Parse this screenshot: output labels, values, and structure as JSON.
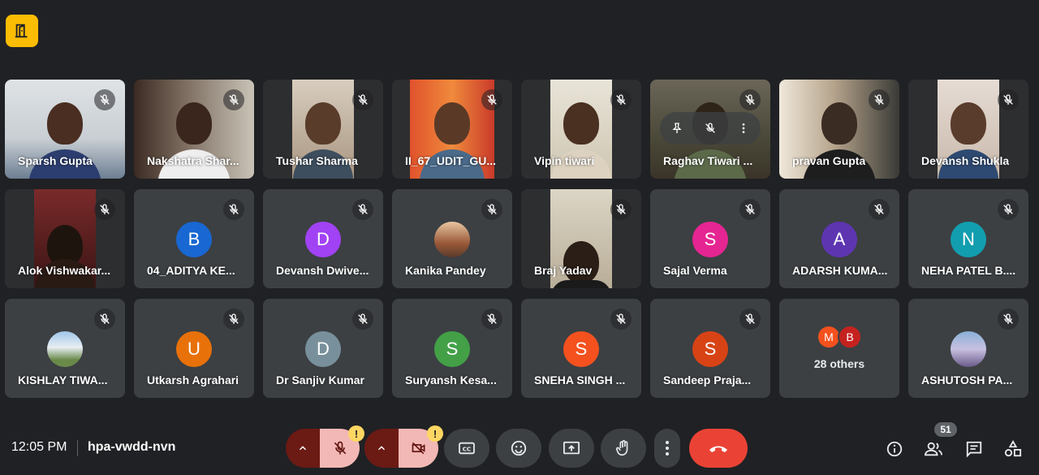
{
  "meeting": {
    "time": "12:05 PM",
    "code": "hpa-vwdd-nvn",
    "participant_count": "51"
  },
  "top_badge_icon": "door-exit-icon",
  "tiles": [
    {
      "name": "Sparsh Gupta"
    },
    {
      "name": "Nakshatra Shar..."
    },
    {
      "name": "Tushar Sharma"
    },
    {
      "name": "II_67_UDIT_GU..."
    },
    {
      "name": "Vipin tiwari"
    },
    {
      "name": "Raghav Tiwari ..."
    },
    {
      "name": "pravan Gupta"
    },
    {
      "name": "Devansh Shukla"
    },
    {
      "name": "Alok Vishwakar..."
    },
    {
      "name": "04_ADITYA KE...",
      "initial": "B",
      "color": "#1967d2"
    },
    {
      "name": "Devansh Dwive...",
      "initial": "D",
      "color": "#a142f4"
    },
    {
      "name": "Kanika Pandey"
    },
    {
      "name": "Braj Yadav"
    },
    {
      "name": "Sajal Verma",
      "initial": "S",
      "color": "#e52592"
    },
    {
      "name": "ADARSH KUMA...",
      "initial": "A",
      "color": "#5e35b1"
    },
    {
      "name": "NEHA PATEL B....",
      "initial": "N",
      "color": "#129eaf"
    },
    {
      "name": "KISHLAY TIWA..."
    },
    {
      "name": "Utkarsh Agrahari",
      "initial": "U",
      "color": "#e8710a"
    },
    {
      "name": "Dr Sanjiv Kumar",
      "initial": "D",
      "color": "#78909c"
    },
    {
      "name": "Suryansh Kesa...",
      "initial": "S",
      "color": "#43a047"
    },
    {
      "name": "SNEHA SINGH ...",
      "initial": "S",
      "color": "#f4511e"
    },
    {
      "name": "Sandeep Praja...",
      "initial": "S",
      "color": "#d84315"
    },
    {
      "others_label": "28 others",
      "others_initials": [
        "M",
        "B"
      ],
      "others_colors": [
        "#f4511e",
        "#c5221f"
      ]
    },
    {
      "name": "ASHUTOSH PA..."
    }
  ],
  "controls": {
    "mic_icon": "mic-off-icon",
    "camera_icon": "camera-off-icon",
    "warning_badge": "!",
    "captions_icon": "captions-icon",
    "emoji_icon": "emoji-icon",
    "present_icon": "present-screen-icon",
    "raise_hand_icon": "raise-hand-icon",
    "more_icon": "more-vert-icon",
    "leave_icon": "call-end-icon"
  },
  "right_icons": [
    "info-icon",
    "people-icon",
    "chat-icon",
    "activities-icon"
  ]
}
